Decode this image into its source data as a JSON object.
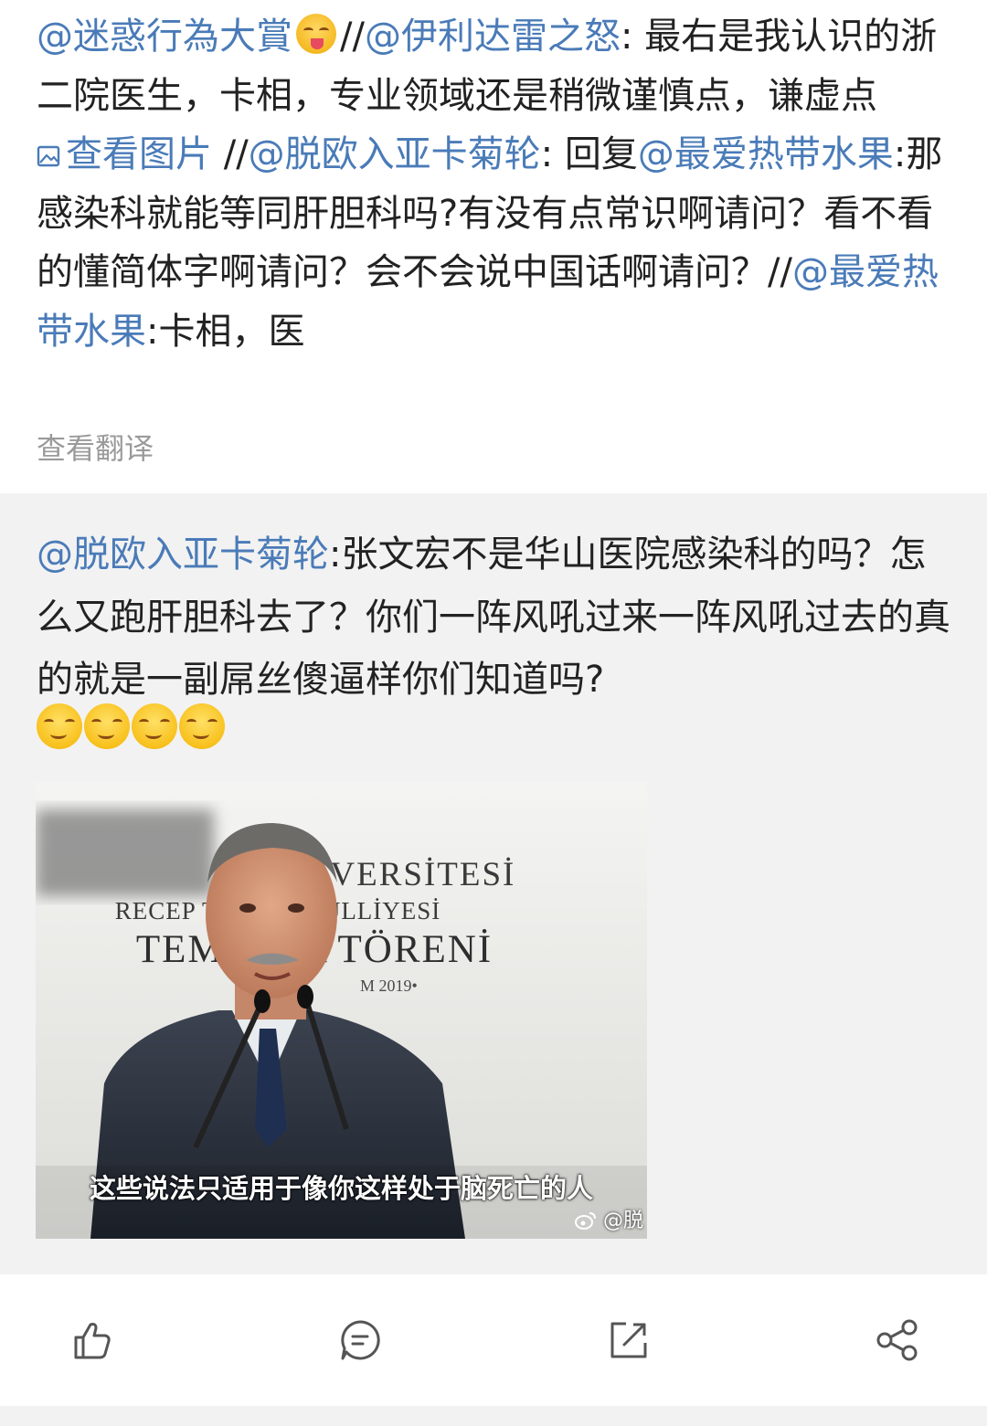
{
  "repost": {
    "segments": [
      {
        "type": "mention",
        "text": "@迷惑行為大賞"
      },
      {
        "type": "emoji",
        "name": "yummy-face-emoji"
      },
      {
        "type": "text",
        "text": "//"
      },
      {
        "type": "mention",
        "text": "@伊利达雷之怒"
      },
      {
        "type": "text",
        "text": ": 最右是我认识的浙二院医生，卡相，专业领域还是稍微谨慎点，谦虚点 "
      },
      {
        "type": "piclink",
        "text": "查看图片"
      },
      {
        "type": "text",
        "text": " //"
      },
      {
        "type": "mention",
        "text": "@脱欧入亚卡菊轮"
      },
      {
        "type": "text",
        "text": ": 回复"
      },
      {
        "type": "mention",
        "text": "@最爱热带水果"
      },
      {
        "type": "text",
        "text": ":那感染科就能等同肝胆科吗?有没有点常识啊请问？看不看的懂简体字啊请问？会不会说中国话啊请问？//"
      },
      {
        "type": "mention",
        "text": "@最爱热带水果"
      },
      {
        "type": "text",
        "text": ":卡相，医"
      }
    ],
    "translate_label": "查看翻译"
  },
  "original": {
    "author_mention": "@脱欧入亚卡菊轮",
    "body": ":张文宏不是华山医院感染科的吗？怎么又跑肝胆科去了？你们一阵风吼过来一阵风吼过去的真的就是一副屌丝傻逼样你们知道吗?",
    "emojis": [
      "smirk-face-emoji",
      "smirk-face-emoji",
      "smirk-face-emoji",
      "smirk-face-emoji"
    ],
    "video": {
      "banner_lines": [
        "ÜNİVERSİTESİ",
        "RECEP TA   ĞAN KÜLLİYESİ",
        "TEME   MA TÖRENİ",
        "M 2019•"
      ],
      "subtitle": "这些说法只适用于像你这样处于脑死亡的人",
      "watermark": "@脱"
    }
  },
  "actions": {
    "icons": [
      "like-icon",
      "comment-icon",
      "repost-icon",
      "share-icon"
    ]
  },
  "colors": {
    "mention": "#4a7bb8",
    "text": "#222222",
    "muted": "#9a9a9a",
    "card_background": "#f2f2f2",
    "icon": "#555555"
  }
}
